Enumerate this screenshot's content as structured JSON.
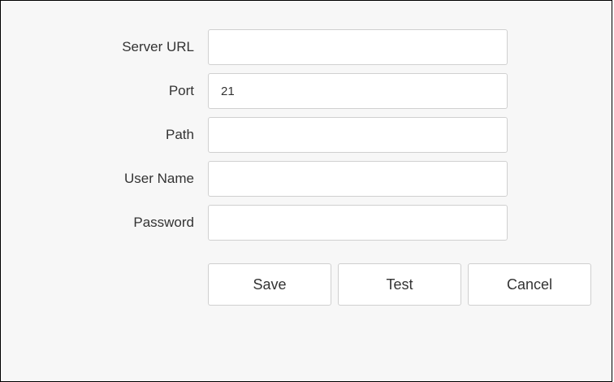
{
  "form": {
    "fields": [
      {
        "label": "Server URL",
        "value": "",
        "placeholder": ""
      },
      {
        "label": "Port",
        "value": "21",
        "placeholder": ""
      },
      {
        "label": "Path",
        "value": "",
        "placeholder": ""
      },
      {
        "label": "User Name",
        "value": "",
        "placeholder": ""
      },
      {
        "label": "Password",
        "value": "",
        "placeholder": ""
      }
    ]
  },
  "buttons": {
    "save_label": "Save",
    "test_label": "Test",
    "cancel_label": "Cancel"
  }
}
